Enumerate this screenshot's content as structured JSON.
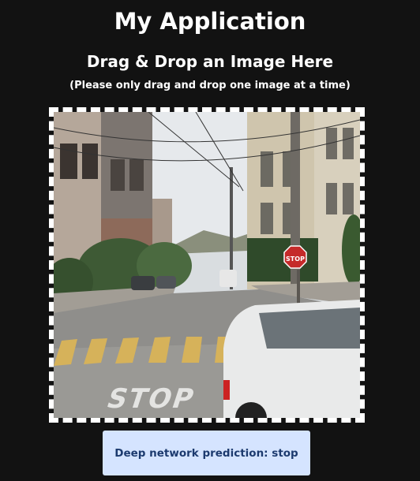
{
  "header": {
    "title": "My Application"
  },
  "dropzone": {
    "heading": "Drag & Drop an Image Here",
    "instructions": "(Please only drag and drop one image at a time)",
    "image_content": "street-scene-stop-sign",
    "road_marking_text": "STOP",
    "sign_text": "STOP"
  },
  "result": {
    "prediction_label": "Deep network prediction: stop"
  },
  "colors": {
    "background": "#121212",
    "text": "#ffffff",
    "button_bg": "#d5e4ff",
    "button_text": "#1c3a6e"
  }
}
